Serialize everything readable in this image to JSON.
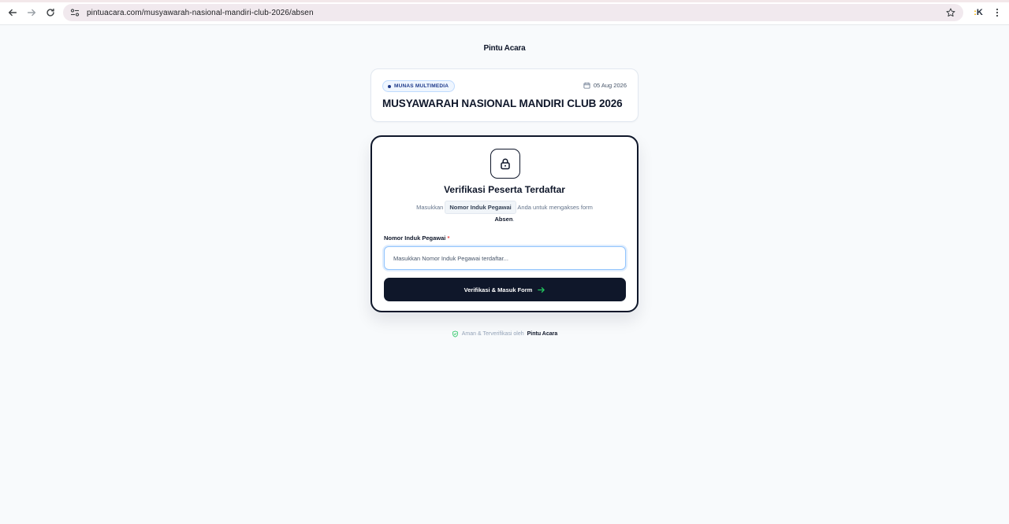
{
  "browser": {
    "url": "pintuacara.com/musyawarah-nasional-mandiri-club-2026/absen",
    "extension_label": "K"
  },
  "brand": {
    "name": "Pintu Acara"
  },
  "event": {
    "badge": "MUNAS MULTIMEDIA",
    "date": "05 Aug 2026",
    "title": "MUSYAWARAH NASIONAL MANDIRI CLUB 2026"
  },
  "verify": {
    "title": "Verifikasi Peserta Terdaftar",
    "desc_prefix": "Masukkan",
    "desc_chip": "Nomor Induk Pegawai",
    "desc_middle": "Anda untuk mengakses form",
    "desc_form": "Absen",
    "desc_end": ".",
    "field_label": "Nomor Induk Pegawai",
    "required_mark": "*",
    "field_placeholder": "Masukkan Nomor Induk Pegawai terdaftar...",
    "field_value": "",
    "submit_label": "Verifikasi & Masuk Form"
  },
  "footer": {
    "note": "Aman & Terverifikasi oleh",
    "brand": "Pintu Acara"
  },
  "colors": {
    "primary": "#0f172a",
    "accent_arrow": "#22c55e",
    "secure_icon": "#22c55e",
    "badge_bg": "#eff6ff",
    "required": "#ef4444"
  }
}
